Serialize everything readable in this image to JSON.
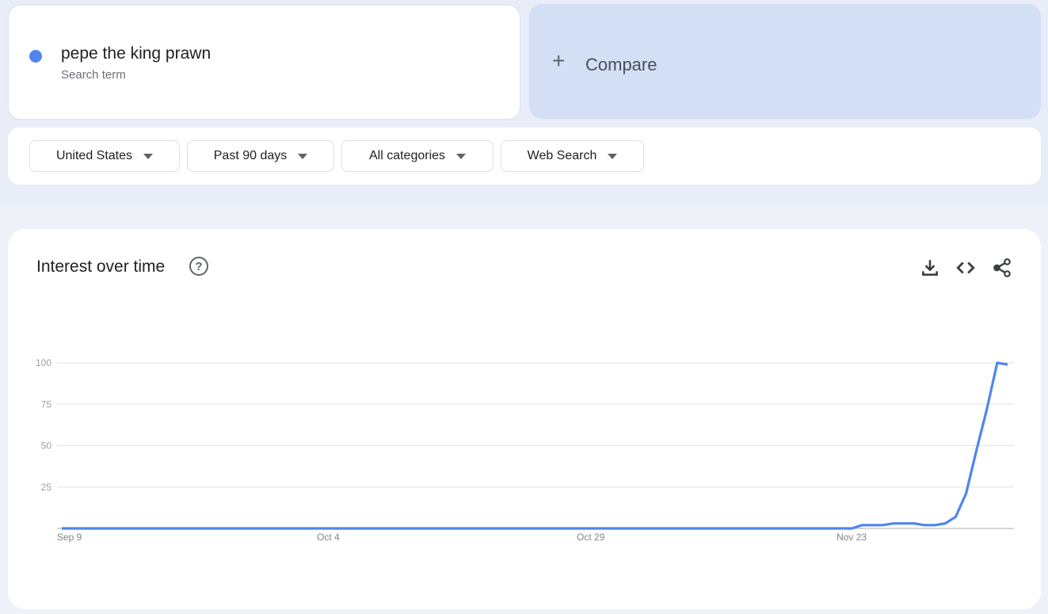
{
  "search_term": {
    "name": "pepe the king prawn",
    "subtitle": "Search term",
    "color": "#4f86ec"
  },
  "compare": {
    "icon": "plus-icon",
    "label": "Compare"
  },
  "filters": [
    {
      "label": "United States"
    },
    {
      "label": "Past 90 days"
    },
    {
      "label": "All categories"
    },
    {
      "label": "Web Search"
    }
  ],
  "panel": {
    "title": "Interest over time",
    "help_icon": "help-circle-icon",
    "actions": [
      "download-icon",
      "embed-code-icon",
      "share-icon"
    ]
  },
  "chart_data": {
    "type": "line",
    "title": "Interest over time",
    "xlabel": "",
    "ylabel": "",
    "ylim": [
      0,
      100
    ],
    "yticks": [
      25,
      50,
      75,
      100
    ],
    "xtick_labels": [
      {
        "label": "Sep 9",
        "day": 0
      },
      {
        "label": "Oct 4",
        "day": 25
      },
      {
        "label": "Oct 29",
        "day": 50
      },
      {
        "label": "Nov 23",
        "day": 75
      }
    ],
    "grid": true,
    "legend": "none",
    "series": [
      {
        "name": "pepe the king prawn",
        "color": "#4f86ec",
        "start_date": "Sep 9",
        "values": [
          0,
          0,
          0,
          0,
          0,
          0,
          0,
          0,
          0,
          0,
          0,
          0,
          0,
          0,
          0,
          0,
          0,
          0,
          0,
          0,
          0,
          0,
          0,
          0,
          0,
          0,
          0,
          0,
          0,
          0,
          0,
          0,
          0,
          0,
          0,
          0,
          0,
          0,
          0,
          0,
          0,
          0,
          0,
          0,
          0,
          0,
          0,
          0,
          0,
          0,
          0,
          0,
          0,
          0,
          0,
          0,
          0,
          0,
          0,
          0,
          0,
          0,
          0,
          0,
          0,
          0,
          0,
          0,
          0,
          0,
          0,
          0,
          0,
          0,
          0,
          0,
          0,
          2,
          2,
          2,
          3,
          3,
          3,
          2,
          2,
          3,
          7,
          21,
          47,
          72,
          100,
          99
        ]
      }
    ]
  }
}
